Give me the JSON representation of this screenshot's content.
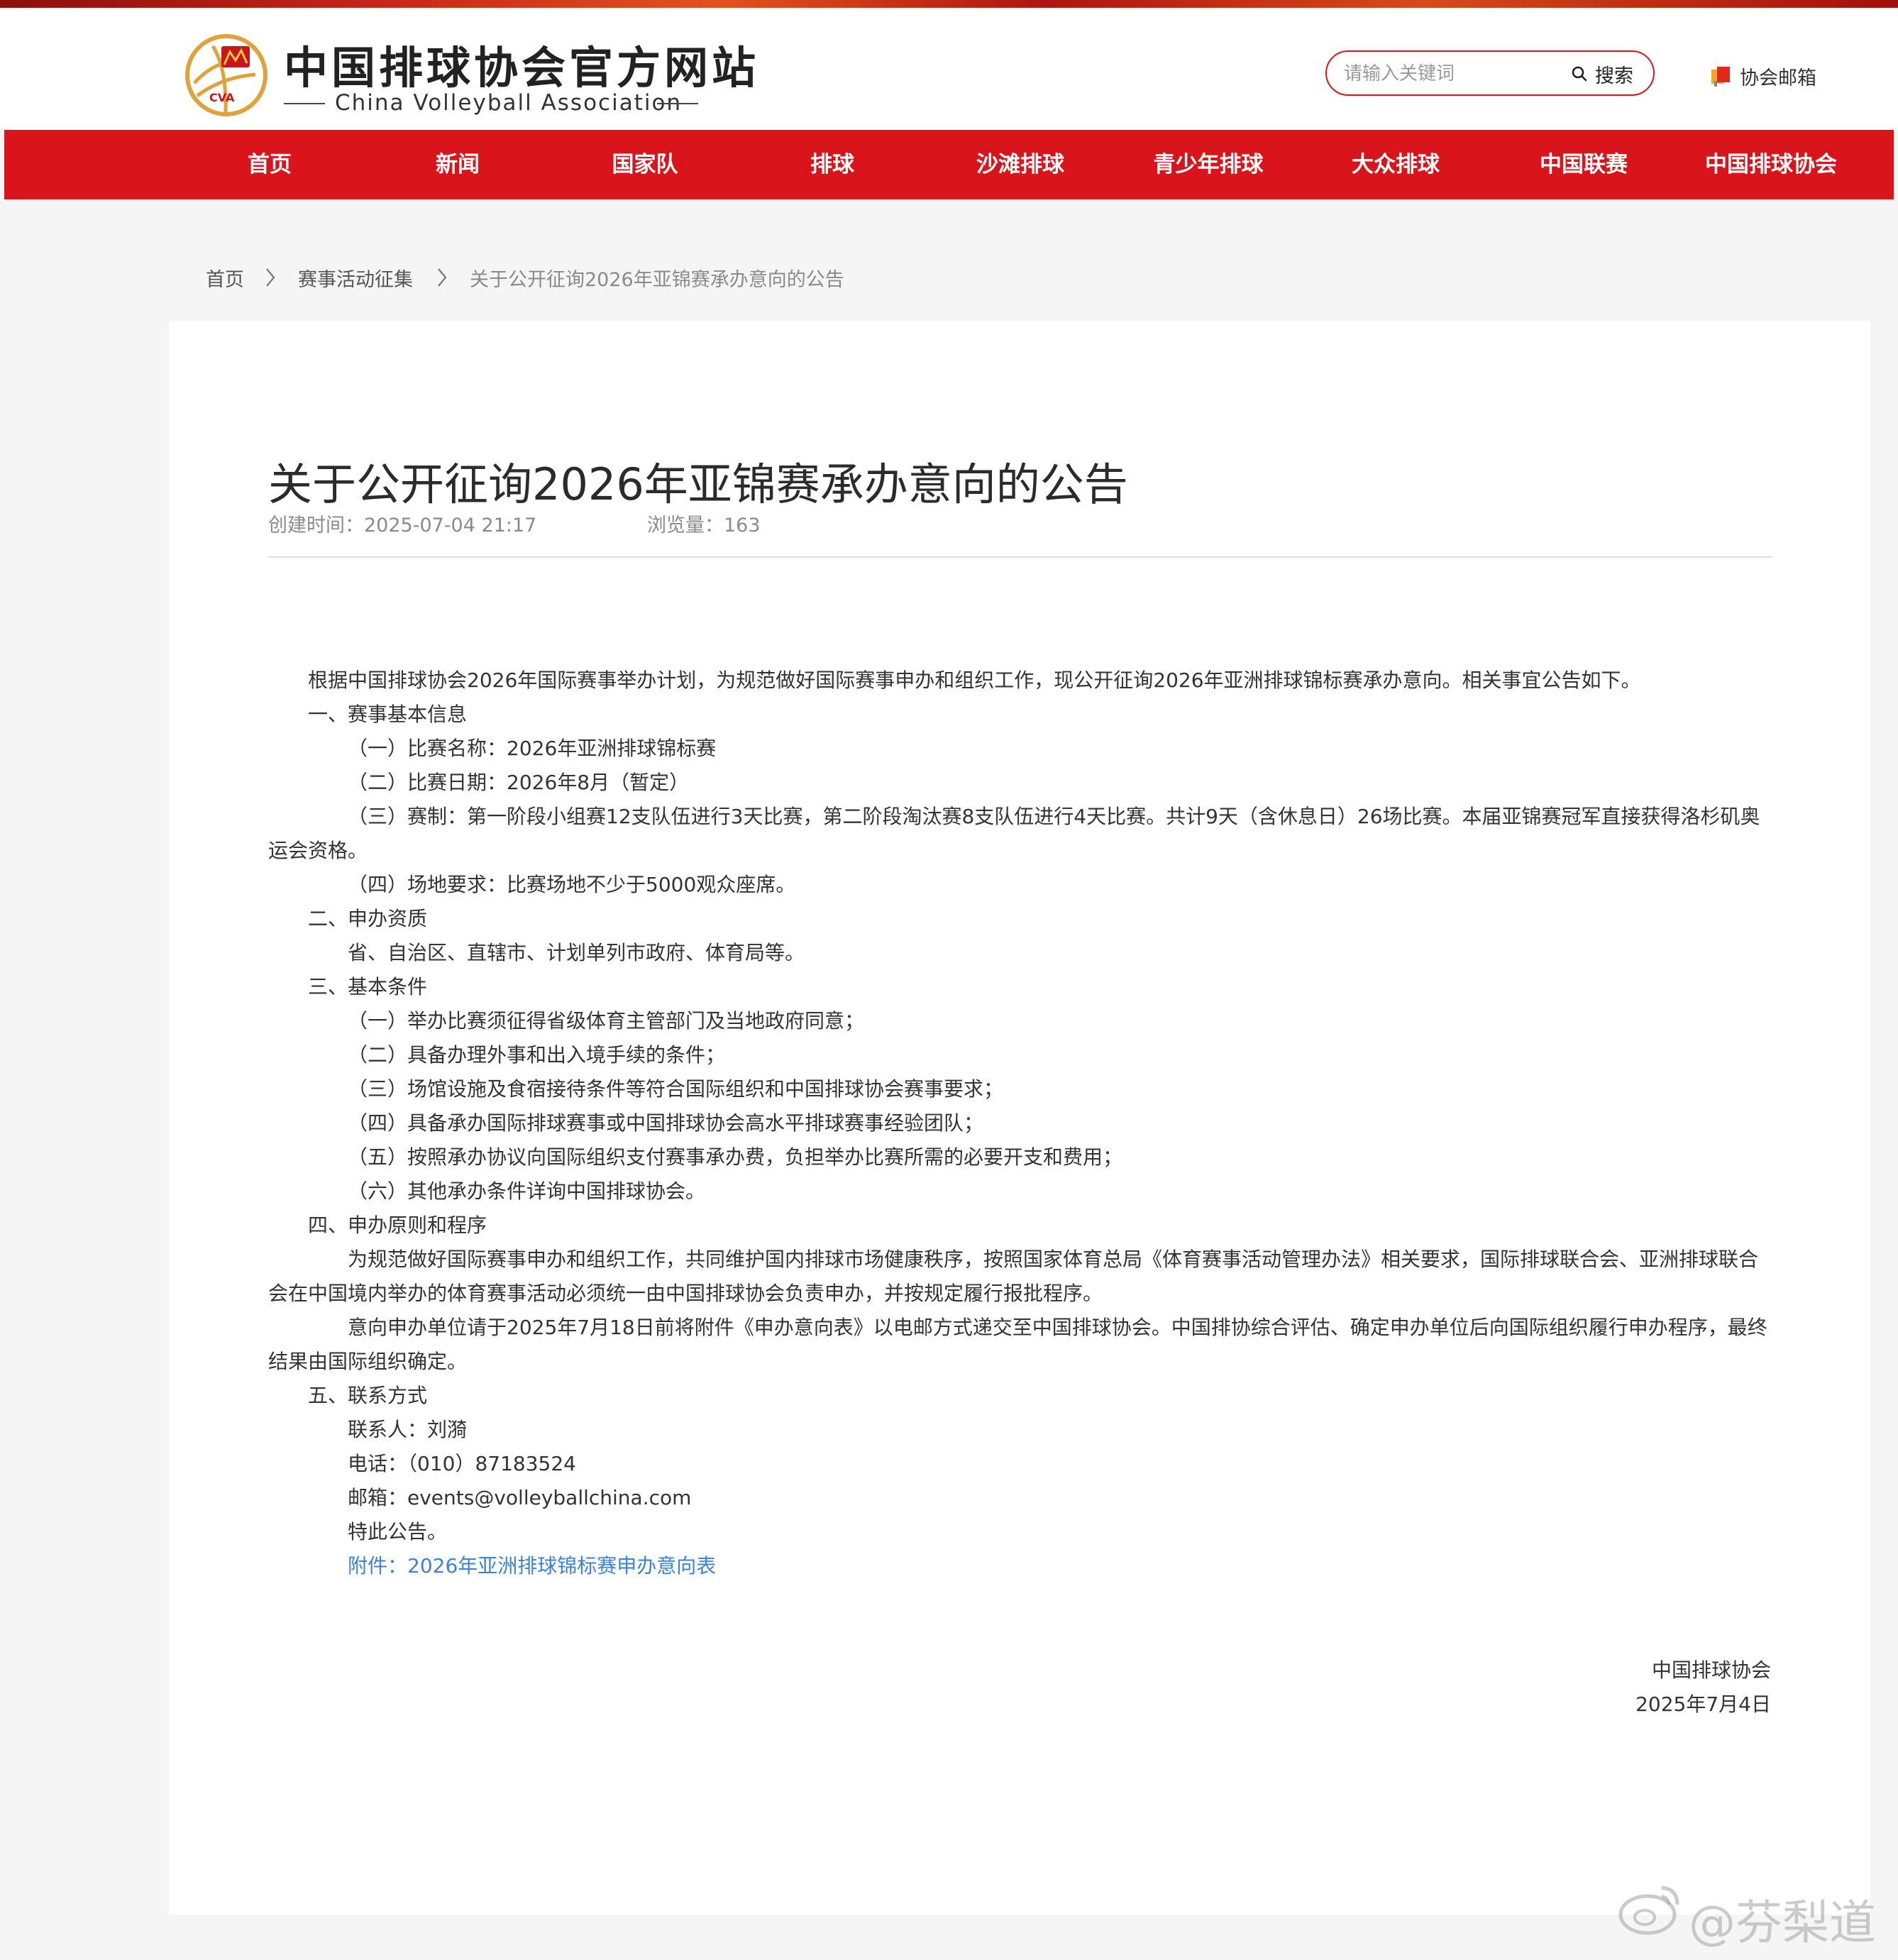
{
  "site": {
    "name_cn": "中国排球协会官方网站",
    "name_en": "China Volleyball Association",
    "logo_emblem_text": "CVA"
  },
  "search": {
    "placeholder": "请输入关键词",
    "button_label": "搜索"
  },
  "mailbox": {
    "label": "协会邮箱"
  },
  "nav": {
    "items": [
      {
        "label": "首页"
      },
      {
        "label": "新闻"
      },
      {
        "label": "国家队"
      },
      {
        "label": "排球"
      },
      {
        "label": "沙滩排球"
      },
      {
        "label": "青少年排球"
      },
      {
        "label": "大众排球"
      },
      {
        "label": "中国联赛"
      },
      {
        "label": "中国排球协会"
      }
    ]
  },
  "breadcrumb": {
    "items": [
      {
        "label": "首页"
      },
      {
        "label": "赛事活动征集"
      },
      {
        "label": "关于公开征询2026年亚锦赛承办意向的公告"
      }
    ]
  },
  "article": {
    "title": "关于公开征询2026年亚锦赛承办意向的公告",
    "created": "创建时间：2025-07-04 21:17",
    "views": "浏览量：163",
    "lines": [
      "根据中国排球协会2026年国际赛事举办计划，为规范做好国际赛事申办和组织工作，现公开征询2026年亚洲排球锦标赛承办意向。相关事宜公告如下。",
      "一、赛事基本信息",
      "（一）比赛名称：2026年亚洲排球锦标赛",
      "（二）比赛日期：2026年8月（暂定）",
      "（三）赛制：第一阶段小组赛12支队伍进行3天比赛，第二阶段淘汰赛8支队伍进行4天比赛。共计9天（含休息日）26场比赛。本届亚锦赛冠军直接获得洛杉矶奥",
      "运会资格。",
      "（四）场地要求：比赛场地不少于5000观众座席。",
      "二、申办资质",
      "省、自治区、直辖市、计划单列市政府、体育局等。",
      "三、基本条件",
      "（一）举办比赛须征得省级体育主管部门及当地政府同意；",
      "（二）具备办理外事和出入境手续的条件；",
      "（三）场馆设施及食宿接待条件等符合国际组织和中国排球协会赛事要求；",
      "（四）具备承办国际排球赛事或中国排球协会高水平排球赛事经验团队；",
      "（五）按照承办协议向国际组织支付赛事承办费，负担举办比赛所需的必要开支和费用；",
      "（六）其他承办条件详询中国排球协会。",
      "四、申办原则和程序",
      "为规范做好国际赛事申办和组织工作，共同维护国内排球市场健康秩序，按照国家体育总局《体育赛事活动管理办法》相关要求，国际排球联合会、亚洲排球联合",
      "会在中国境内举办的体育赛事活动必须统一由中国排球协会负责申办，并按规定履行报批程序。",
      "意向申办单位请于2025年7月18日前将附件《申办意向表》以电邮方式递交至中国排球协会。中国排协综合评估、确定申办单位后向国际组织履行申办程序，最终",
      "结果由国际组织确定。",
      "五、联系方式",
      "联系人：刘漪",
      "电话：（010）87183524",
      "邮箱：events@volleyballchina.com",
      "特此公告。"
    ],
    "attachment": "附件：2026年亚洲排球锦标赛申办意向表",
    "sign_org": "中国排球协会",
    "sign_date": "2025年7月4日"
  },
  "watermark": {
    "text": "@芬梨道"
  },
  "colors": {
    "brand_red": "#d9141b",
    "link_blue": "#3b82d8",
    "logo_gold": "#e0a23a"
  }
}
